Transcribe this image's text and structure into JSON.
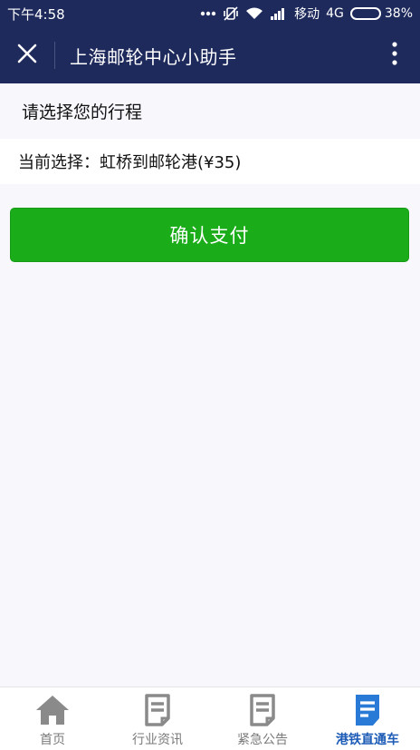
{
  "status_bar": {
    "time": "下午4:58",
    "carrier": "移动",
    "network": "4G",
    "battery": "38%",
    "battery_level": 0.38
  },
  "header": {
    "title": "上海邮轮中心小助手",
    "close_icon": "close-icon",
    "more_icon": "more-vertical-icon",
    "background": "#1e2a5c"
  },
  "main": {
    "section_label": "请选择您的行程",
    "current_selection": "当前选择：虹桥到邮轮港(¥35)",
    "confirm_button": "确认支付",
    "button_color": "#1aad19"
  },
  "tabs": [
    {
      "label": "首页",
      "icon": "home-icon",
      "active": false
    },
    {
      "label": "行业资讯",
      "icon": "document-icon",
      "active": false
    },
    {
      "label": "紧急公告",
      "icon": "document-icon",
      "active": false
    },
    {
      "label": "港铁直通车",
      "icon": "document-icon",
      "active": true
    }
  ],
  "colors": {
    "active_tab": "#1c5bb6",
    "inactive_tab": "#8a8a8a"
  }
}
